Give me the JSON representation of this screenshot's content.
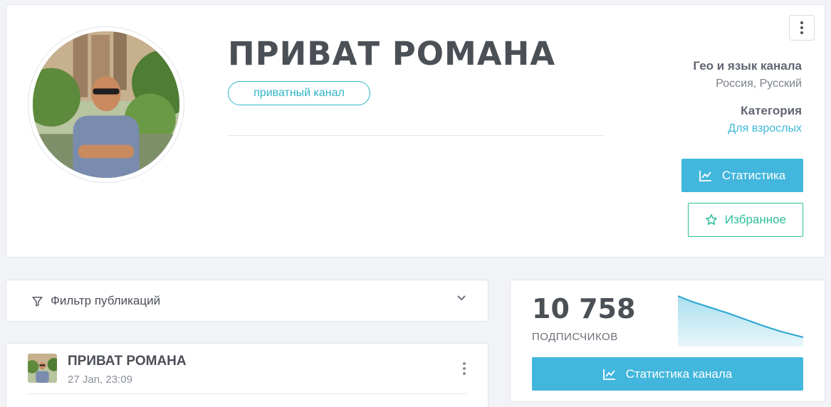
{
  "header": {
    "title": "ПРИВАТ РОМАНА",
    "badge": "приватный канал",
    "geo_label": "Гео и язык канала",
    "geo_value": "Россия, Русский",
    "category_label": "Категория",
    "category_value": "Для взрослых",
    "stats_button": "Статистика",
    "favorite_button": "Избранное",
    "icons": [
      "chart-line-icon",
      "star-icon",
      "more-vertical-icon"
    ]
  },
  "filter": {
    "label": "Фильтр публикаций",
    "icons": [
      "filter-icon",
      "chevron-down-icon"
    ]
  },
  "post": {
    "author": "ПРИВАТ РОМАНА",
    "date": "27 Jan, 23:09"
  },
  "subscribers": {
    "count": "10 758",
    "label": "ПОДПИСЧИКОВ",
    "button": "Статистика канала",
    "trend": "declining"
  },
  "colors": {
    "accent_blue": "#42b6dc",
    "badge_teal": "#2fb5c6",
    "favorite_green": "#2ebf99",
    "text_dark": "#4b4f56",
    "background": "#f2f3f7"
  }
}
